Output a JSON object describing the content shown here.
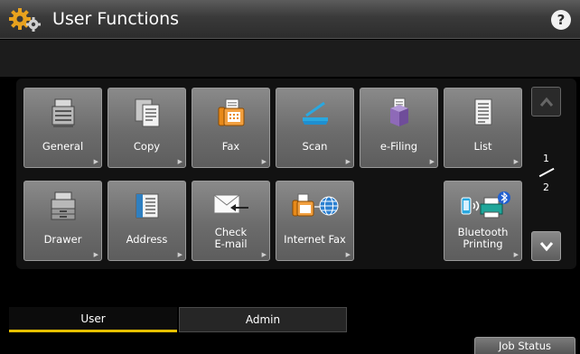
{
  "header": {
    "title": "User Functions",
    "title_icon": "gears-icon",
    "help_label": "?"
  },
  "functions": {
    "row1": [
      {
        "id": "general",
        "label": "General",
        "icon": "printer-gear-icon"
      },
      {
        "id": "copy",
        "label": "Copy",
        "icon": "copy-document-icon"
      },
      {
        "id": "fax",
        "label": "Fax",
        "icon": "fax-machine-icon"
      },
      {
        "id": "scan",
        "label": "Scan",
        "icon": "scanner-icon"
      },
      {
        "id": "efiling",
        "label": "e-Filing",
        "icon": "filing-box-icon"
      },
      {
        "id": "list",
        "label": "List",
        "icon": "list-document-icon"
      }
    ],
    "row2": [
      {
        "id": "drawer",
        "label": "Drawer",
        "icon": "printer-drawer-icon"
      },
      {
        "id": "address",
        "label": "Address",
        "icon": "address-book-icon"
      },
      {
        "id": "check_email",
        "label": "Check\nE-mail",
        "icon": "envelope-icon"
      },
      {
        "id": "internet_fax",
        "label": "Internet Fax",
        "icon": "internet-fax-icon"
      },
      {
        "id": "bluetooth",
        "label": "Bluetooth\nPrinting",
        "icon": "bluetooth-printing-icon"
      }
    ]
  },
  "pagination": {
    "current": "1",
    "total": "2"
  },
  "tabs": {
    "user": "User",
    "admin": "Admin",
    "active": "User"
  },
  "footer": {
    "job_status": "Job Status"
  },
  "colors": {
    "active_tab_underline": "#e6c000",
    "fax_orange": "#e88a1a",
    "scan_blue": "#2aa8e0",
    "efiling_purple": "#8e6ab8"
  }
}
